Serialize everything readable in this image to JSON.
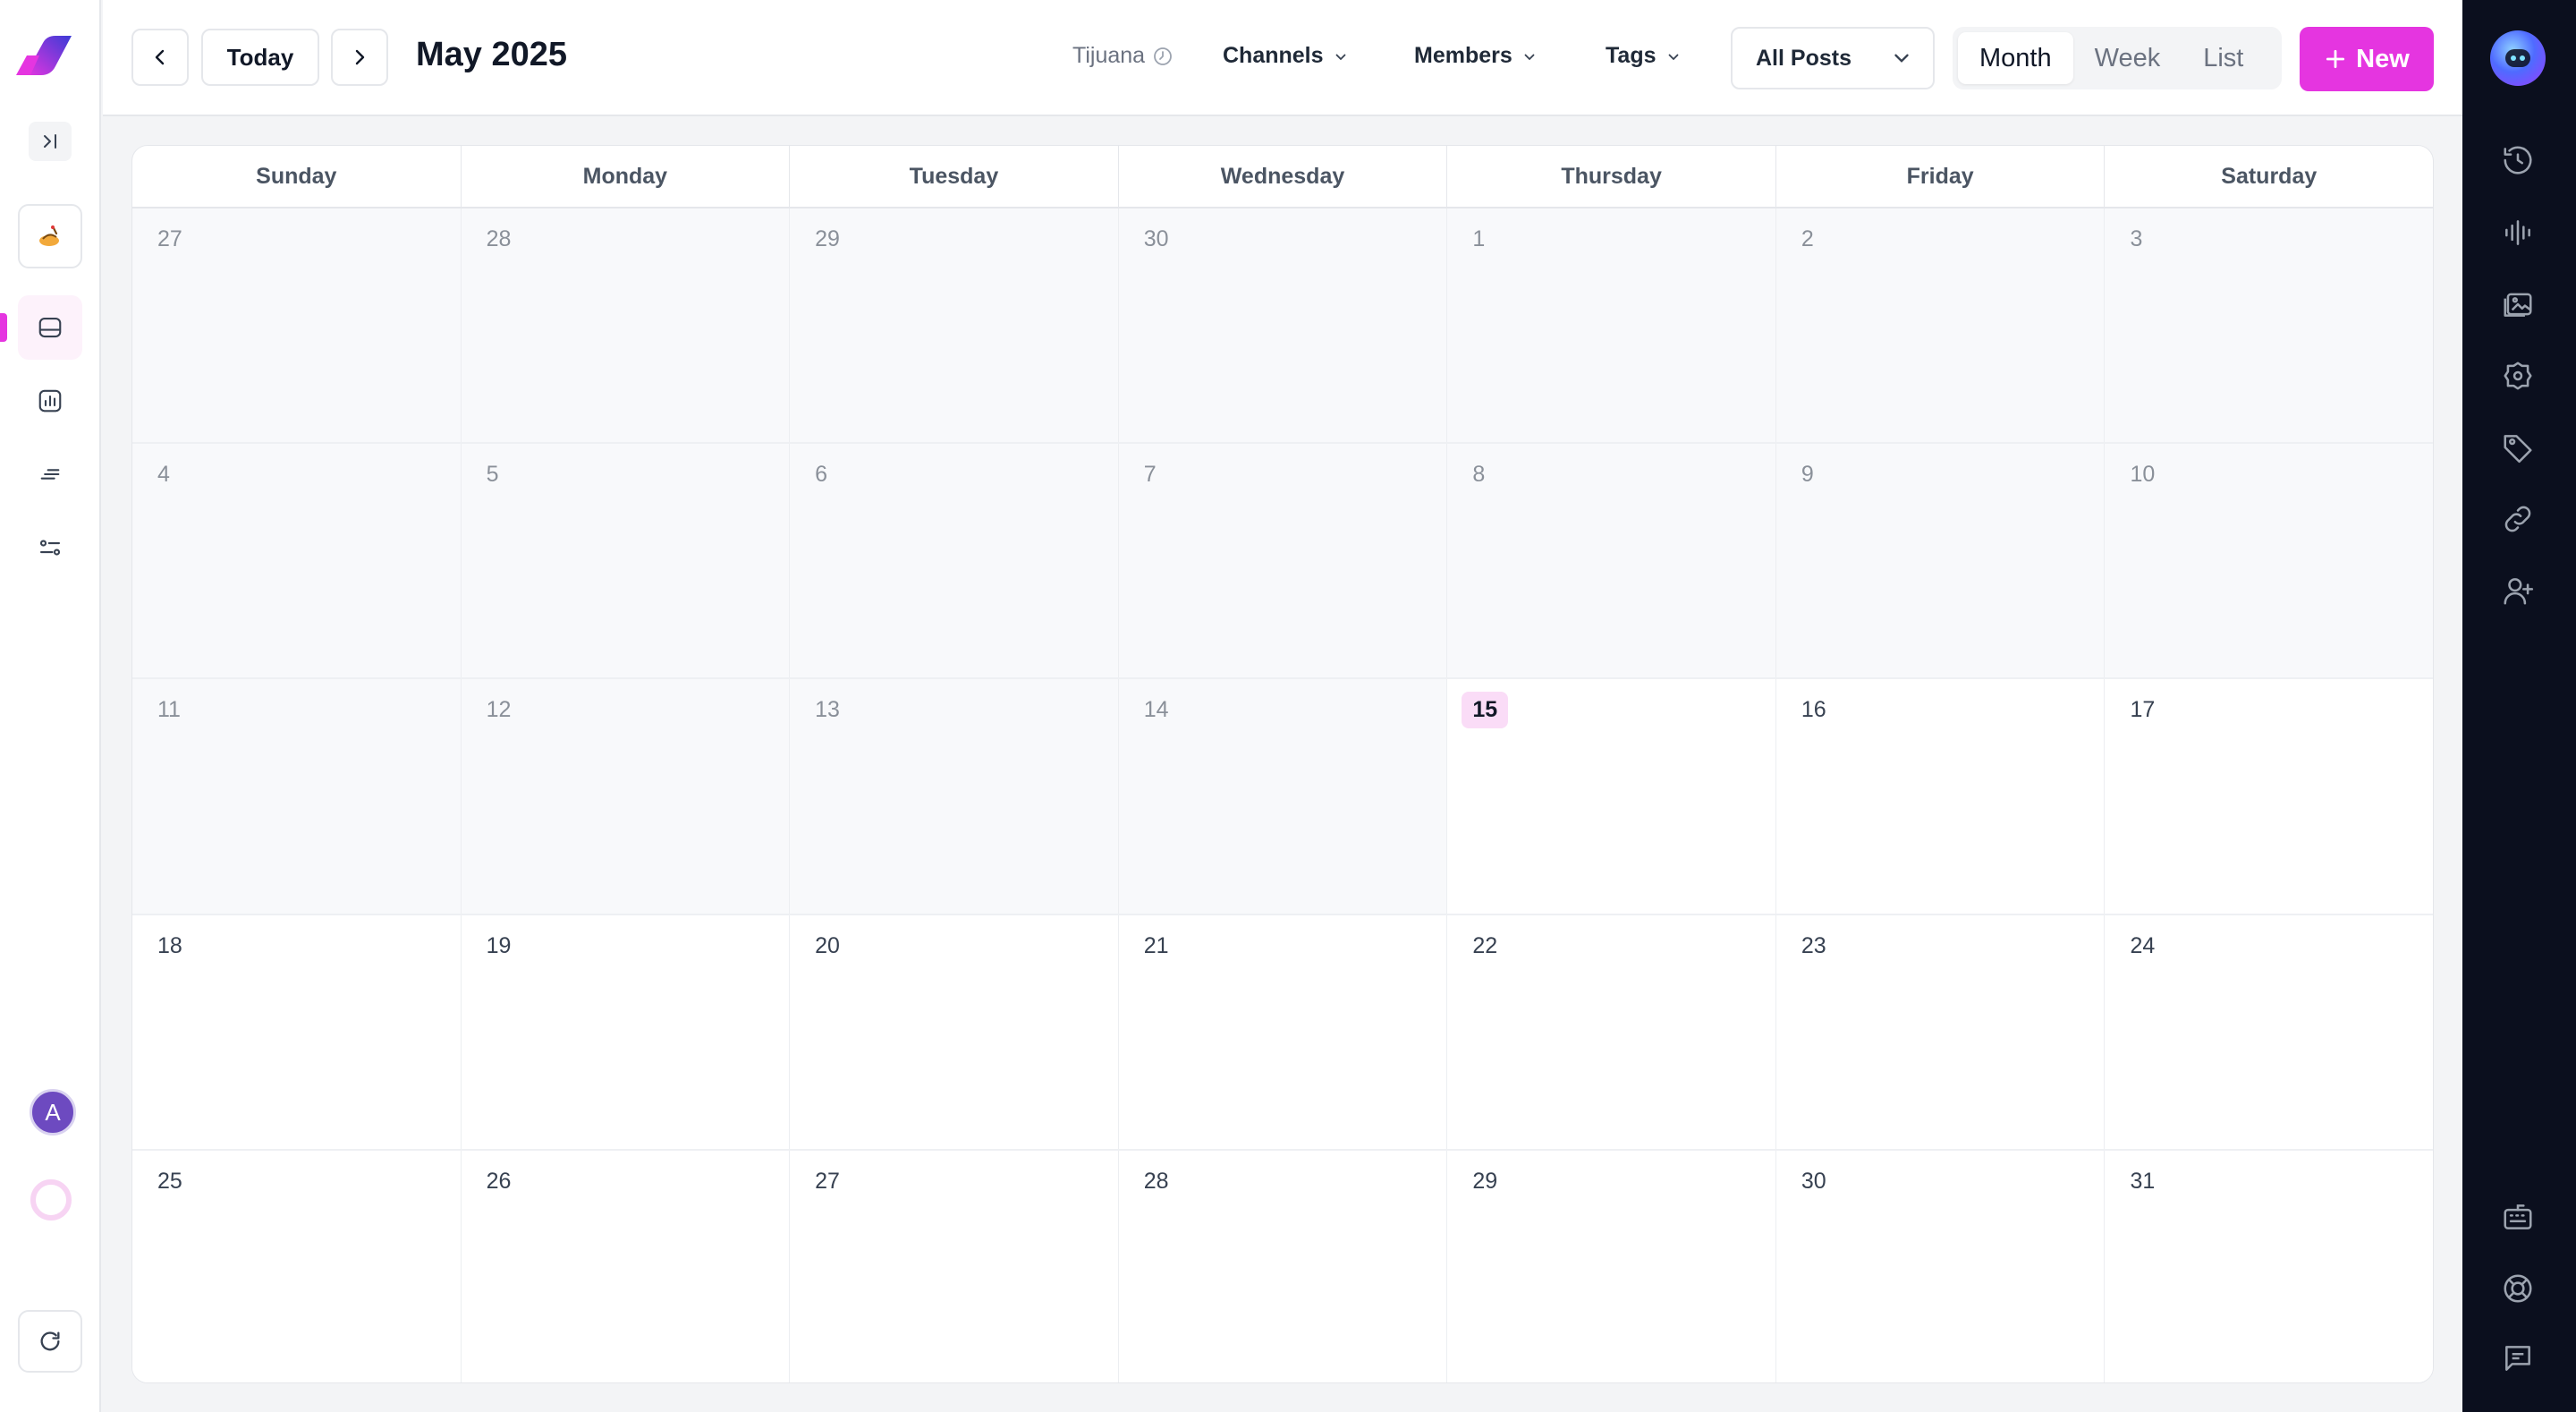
{
  "header": {
    "today_label": "Today",
    "title": "May 2025",
    "timezone": "Tijuana",
    "filters": [
      {
        "label": "Channels"
      },
      {
        "label": "Members"
      },
      {
        "label": "Tags"
      }
    ],
    "posts_select": "All Posts",
    "views": [
      {
        "label": "Month",
        "active": true
      },
      {
        "label": "Week",
        "active": false
      },
      {
        "label": "List",
        "active": false
      }
    ],
    "new_button": "New"
  },
  "calendar": {
    "weekdays": [
      "Sunday",
      "Monday",
      "Tuesday",
      "Wednesday",
      "Thursday",
      "Friday",
      "Saturday"
    ],
    "weeks": [
      [
        "27",
        "28",
        "29",
        "30",
        "1",
        "2",
        "3"
      ],
      [
        "4",
        "5",
        "6",
        "7",
        "8",
        "9",
        "10"
      ],
      [
        "11",
        "12",
        "13",
        "14",
        "15",
        "16",
        "17"
      ],
      [
        "18",
        "19",
        "20",
        "21",
        "22",
        "23",
        "24"
      ],
      [
        "25",
        "26",
        "27",
        "28",
        "29",
        "30",
        "31"
      ]
    ],
    "today": "15"
  },
  "user": {
    "avatar_initial": "A"
  },
  "colors": {
    "accent": "#e535e0",
    "right_rail": "#0b0f1e",
    "today_badge": "#fadcf7"
  },
  "left_sidebar_icons": [
    "logo-icon",
    "expand-sidebar-icon",
    "brand-icon",
    "inbox-icon",
    "analytics-icon",
    "list-sort-icon",
    "settings-sliders-icon",
    "refresh-icon"
  ],
  "right_rail_icons": [
    "assistant-bot-icon",
    "history-icon",
    "audio-waveform-icon",
    "media-images-icon",
    "badge-settings-icon",
    "tag-icon",
    "link-icon",
    "add-user-icon",
    "keyboard-icon",
    "help-lifebuoy-icon",
    "feedback-message-icon"
  ]
}
